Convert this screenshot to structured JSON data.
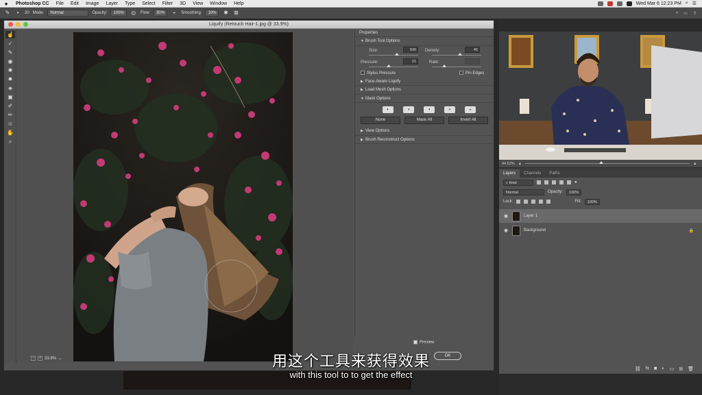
{
  "menubar": {
    "apple": "",
    "app_name": "Photoshop CC",
    "items": [
      "File",
      "Edit",
      "Image",
      "Layer",
      "Type",
      "Select",
      "Filter",
      "3D",
      "View",
      "Window",
      "Help"
    ],
    "datetime": "Wed Mar 6  12:23 PM"
  },
  "options_bar": {
    "brush_size": "20",
    "mode_label": "Mode:",
    "mode_value": "Normal",
    "opacity_label": "Opacity:",
    "opacity_value": "100%",
    "flow_label": "Flow:",
    "flow_value": "30%",
    "smoothing_label": "Smoothing:",
    "smoothing_value": "10%"
  },
  "dialog": {
    "title": "Liquify (Retouch Hair-1.jpg @ 33.9%)",
    "zoom": "33.9%",
    "properties_header": "Properties",
    "brush_tool_options": "Brush Tool Options",
    "size_label": "Size:",
    "size_value": "930",
    "density_label": "Density:",
    "density_value": "45",
    "pressure_label": "Pressure:",
    "pressure_value": "21",
    "rate_label": "Rate:",
    "rate_value": "",
    "stylus_pressure": "Stylus Pressure",
    "pin_edges": "Pin Edges",
    "face_aware": "Face-Aware Liquify",
    "load_mesh": "Load Mesh Options",
    "mask_options": "Mask Options",
    "mask_none": "None",
    "mask_all": "Mask All",
    "invert_all": "Invert All",
    "view_options": "View Options",
    "brush_reconstruct": "Brush Reconstruct Options",
    "preview_label": "Preview",
    "ok_label": "OK"
  },
  "video": {
    "zoom": "44.62%"
  },
  "layers": {
    "tabs": [
      "Layers",
      "Channels",
      "Paths"
    ],
    "kind_label": "Kind",
    "blend_mode": "Normal",
    "opacity_label": "Opacity:",
    "opacity_value": "100%",
    "lock_label": "Lock:",
    "fill_label": "Fill:",
    "fill_value": "100%",
    "layer1": "Layer 1",
    "background": "Background"
  },
  "subtitles": {
    "chinese": "用这个工具来获得效果",
    "english": "with this tool to to get the effect"
  }
}
